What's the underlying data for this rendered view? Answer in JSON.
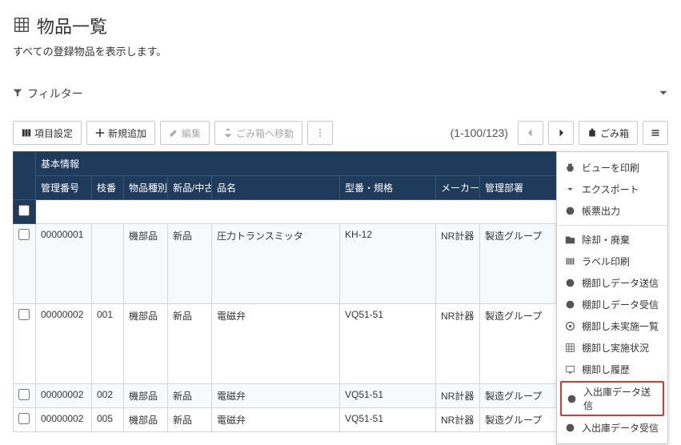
{
  "page": {
    "title": "物品一覧",
    "subtitle": "すべての登録物品を表示します。"
  },
  "filter": {
    "label": "フィルター"
  },
  "toolbar": {
    "columns": "項目設定",
    "add": "新規追加",
    "edit": "編集",
    "trash_move": "ごみ箱へ移動",
    "pager": "(1-100/123)",
    "trash": "ごみ箱"
  },
  "table": {
    "group": "基本情報",
    "headers": {
      "id": "管理番号",
      "branch": "枝番",
      "type": "物品種別",
      "cond": "新品/中古",
      "name": "品名",
      "model": "型番・規格",
      "maker": "メーカー",
      "dept": "管理部署"
    },
    "rows": [
      {
        "id": "00000001",
        "branch": "",
        "type": "機部品",
        "cond": "新品",
        "name": "圧力トランスミッタ",
        "model": "KH-12",
        "maker": "NR計器",
        "dept": "製造グループ"
      },
      {
        "id": "00000002",
        "branch": "001",
        "type": "機部品",
        "cond": "新品",
        "name": "電磁弁",
        "model": "VQ51-51",
        "maker": "NR計器",
        "dept": "製造グループ"
      },
      {
        "id": "00000002",
        "branch": "002",
        "type": "機部品",
        "cond": "新品",
        "name": "電磁弁",
        "model": "VQ51-51",
        "maker": "NR計器",
        "dept": "製造グループ"
      },
      {
        "id": "00000002",
        "branch": "005",
        "type": "機部品",
        "cond": "新品",
        "name": "電磁弁",
        "model": "VQ51-51",
        "maker": "NR計器",
        "dept": "製造グループ"
      }
    ]
  },
  "menu": {
    "print": "ビューを印刷",
    "export": "エクスポート",
    "report": "帳票出力",
    "dispose": "除却・廃棄",
    "label": "ラベル印刷",
    "inv_send": "棚卸しデータ送信",
    "inv_recv": "棚卸しデータ受信",
    "inv_pending": "棚卸し未実施一覧",
    "inv_status": "棚卸し実施状況",
    "inv_hist": "棚卸し履歴",
    "io_send": "入出庫データ送信",
    "io_recv": "入出庫データ受信"
  }
}
